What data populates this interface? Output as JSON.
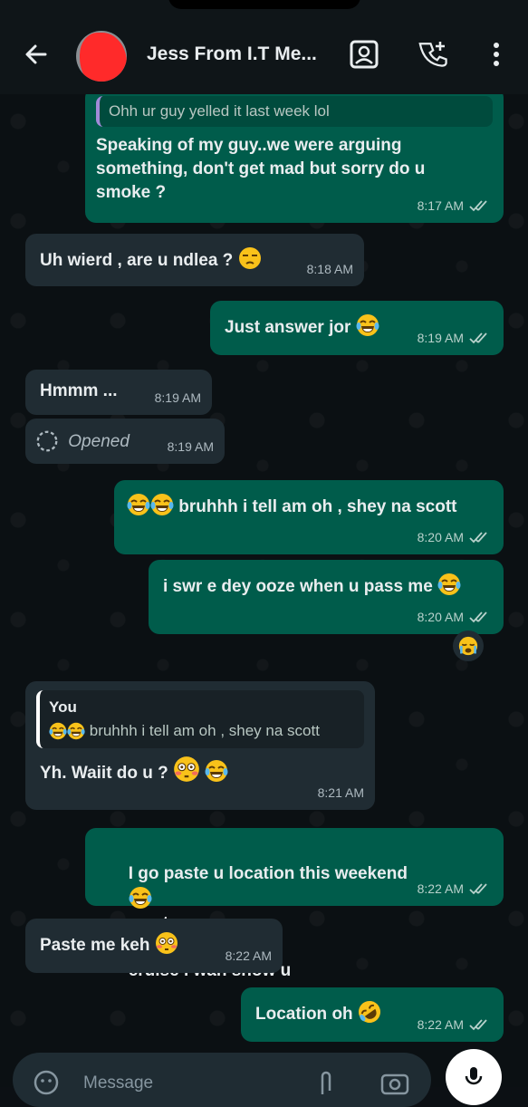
{
  "header": {
    "contact_name": "Jess From I.T Me...",
    "icons": [
      "back-arrow-icon",
      "avatar",
      "video-call-icon",
      "add-call-icon",
      "more-vert-icon"
    ]
  },
  "messages": [
    {
      "id": "m1",
      "direction": "out",
      "quote": "Ohh ur guy yelled it last week lol",
      "text": "Speaking of my guy..we were arguing\nsomething, don't get mad but sorry do u\nsmoke ?",
      "time": "8:17 AM",
      "ticks": "read"
    },
    {
      "id": "m2",
      "direction": "in",
      "text": "Uh wierd , are u ndlea ?",
      "emoji": "unamused-face",
      "time": "8:18 AM"
    },
    {
      "id": "m3",
      "direction": "out",
      "text": "Just answer jor",
      "emoji": "tears-of-joy",
      "time": "8:19 AM",
      "ticks": "read"
    },
    {
      "id": "m4",
      "direction": "in",
      "text": "Hmmm ...",
      "time": "8:19 AM"
    },
    {
      "id": "m5",
      "direction": "in",
      "view_once": "Opened",
      "time": "8:19 AM"
    },
    {
      "id": "m6",
      "direction": "out",
      "text": "bruhhh i tell am oh , shey na scott",
      "emoji_prefix": "tears-of-joy x2",
      "time": "8:20 AM",
      "ticks": "read"
    },
    {
      "id": "m7",
      "direction": "out",
      "text": "i swr e dey ooze when u pass me",
      "emoji": "tears-of-joy",
      "time": "8:20 AM",
      "ticks": "read",
      "reaction": "crying-face"
    },
    {
      "id": "m8",
      "direction": "in",
      "quote_author": "You",
      "quote": "bruhhh i tell am oh , shey na scott",
      "text": "Yh. Waiit do u ?",
      "emoji": "flushed-face tears-of-joy",
      "time": "8:21 AM"
    },
    {
      "id": "m9",
      "direction": "out",
      "text_a": "I go paste u location this weekend",
      "text_b": "e get",
      "text_c": "cruise i wan show u",
      "emoji": "tears-of-joy",
      "time": "8:22 AM",
      "ticks": "read"
    },
    {
      "id": "m10",
      "direction": "in",
      "text": "Paste me keh",
      "emoji": "flushed-face",
      "time": "8:22 AM"
    },
    {
      "id": "m11",
      "direction": "out",
      "text": "Location oh",
      "emoji": "rolling-laughing",
      "time": "8:22 AM",
      "ticks": "read"
    }
  ],
  "composer": {
    "placeholder": "Message"
  },
  "colors": {
    "outgoing": "#005c4b",
    "incoming": "#202c33",
    "background": "#0b1013",
    "header": "#0f1518"
  }
}
